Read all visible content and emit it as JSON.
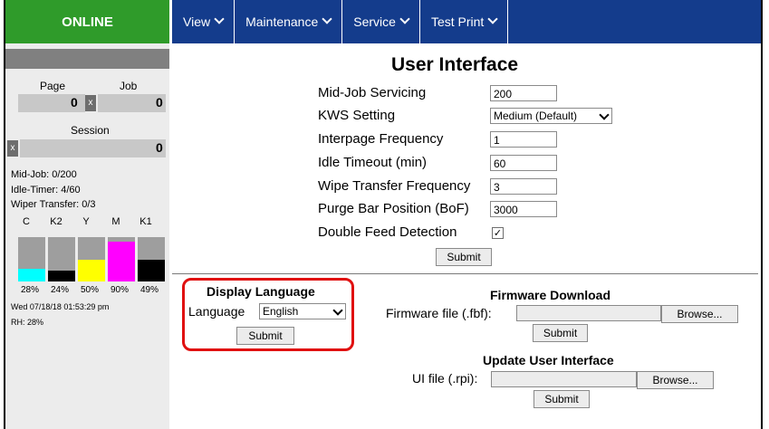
{
  "status": {
    "label": "ONLINE"
  },
  "nav": {
    "view": "View",
    "maintenance": "Maintenance",
    "service": "Service",
    "test_print": "Test Print"
  },
  "counters": {
    "page_label": "Page",
    "job_label": "Job",
    "session_label": "Session",
    "page_value": "0",
    "job_value": "0",
    "session_value": "0",
    "reset_glyph": "x"
  },
  "stats": {
    "mid_job": "Mid-Job: 0/200",
    "idle_timer": "Idle-Timer: 4/60",
    "wiper_transfer": "Wiper Transfer: 0/3"
  },
  "inks": [
    {
      "label": "C",
      "percent_text": "28%",
      "level": 0.28,
      "color": "#00ffff"
    },
    {
      "label": "K2",
      "percent_text": "24%",
      "level": 0.24,
      "color": "#000000"
    },
    {
      "label": "Y",
      "percent_text": "50%",
      "level": 0.5,
      "color": "#ffff00"
    },
    {
      "label": "M",
      "percent_text": "90%",
      "level": 0.9,
      "color": "#ff00ff"
    },
    {
      "label": "K1",
      "percent_text": "49%",
      "level": 0.49,
      "color": "#000000"
    }
  ],
  "datetime": "Wed 07/18/18 01:53:29 pm",
  "humidity": "RH: 28%",
  "ui": {
    "title": "User Interface",
    "mid_job_servicing": {
      "label": "Mid-Job Servicing",
      "value": "200"
    },
    "kws_setting": {
      "label": "KWS Setting",
      "value": "Medium (Default)"
    },
    "interpage_frequency": {
      "label": "Interpage Frequency",
      "value": "1"
    },
    "idle_timeout": {
      "label": "Idle Timeout (min)",
      "value": "60"
    },
    "wipe_transfer_frequency": {
      "label": "Wipe Transfer Frequency",
      "value": "3"
    },
    "purge_bar_position": {
      "label": "Purge Bar Position (BoF)",
      "value": "3000"
    },
    "double_feed_detection": {
      "label": "Double Feed Detection",
      "checked": true,
      "check_glyph": "✓"
    },
    "submit": "Submit"
  },
  "display_language": {
    "heading": "Display Language",
    "label": "Language",
    "value": "English",
    "submit": "Submit"
  },
  "firmware": {
    "heading": "Firmware Download",
    "label": "Firmware file (.fbf):",
    "browse": "Browse...",
    "submit": "Submit"
  },
  "update_ui": {
    "heading": "Update User Interface",
    "label": "UI file (.rpi):",
    "browse": "Browse...",
    "submit": "Submit"
  },
  "colors": {
    "online": "#2f9b2a",
    "nav": "#143c8c",
    "highlight": "#e01010"
  }
}
